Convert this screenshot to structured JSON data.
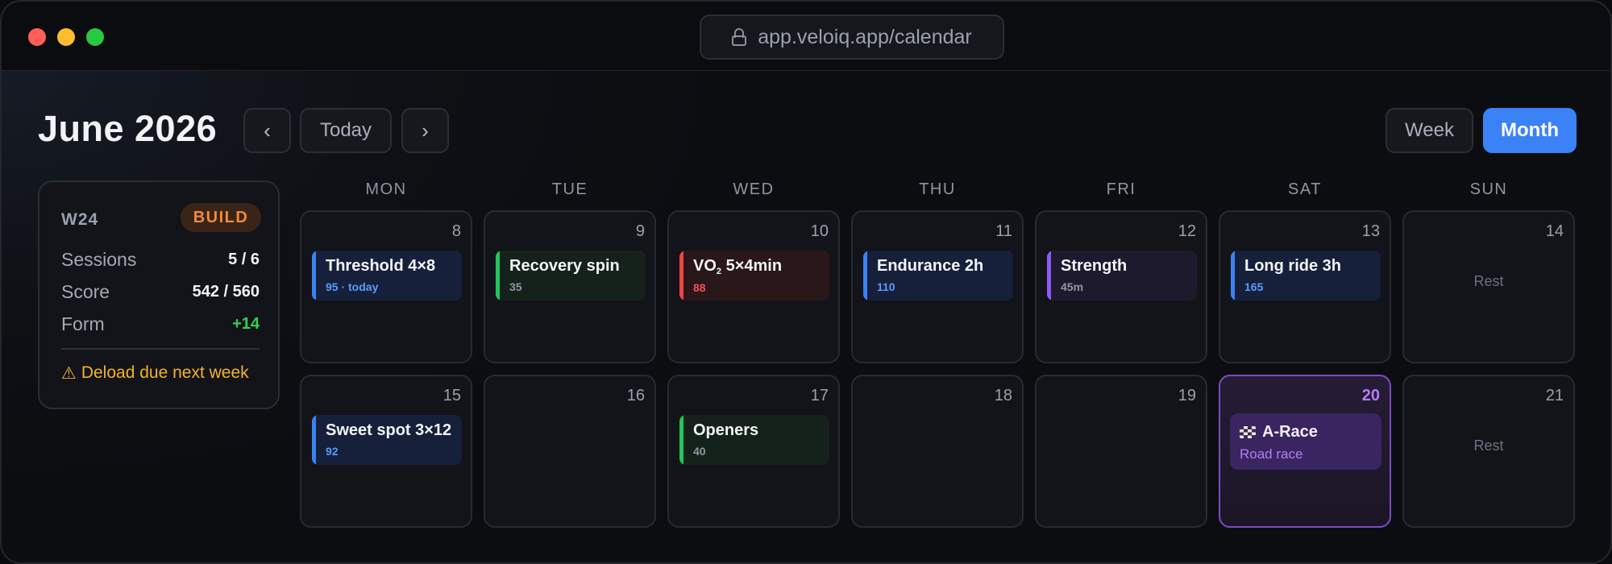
{
  "browser": {
    "url": "app.veloiq.app/calendar"
  },
  "header": {
    "month_title": "June 2026",
    "prev_label": "‹",
    "today_label": "Today",
    "next_label": "›",
    "view_week_label": "Week",
    "view_month_label": "Month",
    "active_view": "Month"
  },
  "week_summary": {
    "week": "W24",
    "phase": "BUILD",
    "sessions_label": "Sessions",
    "sessions_value": "5 / 6",
    "score_label": "Score",
    "score_value": "542 / 560",
    "form_label": "Form",
    "form_value": "+14",
    "alert_icon": "⚠",
    "alert_text": "Deload due next week"
  },
  "weekdays": [
    "MON",
    "TUE",
    "WED",
    "THU",
    "FRI",
    "SAT",
    "SUN"
  ],
  "week1": {
    "d8": {
      "day": "8",
      "title": "Threshold 4×8",
      "meta": "95 · today",
      "color": "#3b82f6"
    },
    "d9": {
      "day": "9",
      "title": "Recovery spin",
      "meta": "35",
      "color": "#22c55e"
    },
    "d10": {
      "day": "10",
      "title_pre": "VO",
      "title_sub": "2",
      "title_post": " 5×4min",
      "meta": "88",
      "color": "#ef4444"
    },
    "d11": {
      "day": "11",
      "title": "Endurance 2h",
      "meta": "110",
      "color": "#3b82f6"
    },
    "d12": {
      "day": "12",
      "title": "Strength",
      "meta": "45m",
      "color": "#8b5cf6"
    },
    "d13": {
      "day": "13",
      "title": "Long ride 3h",
      "meta": "165",
      "color": "#3b82f6"
    },
    "d14": {
      "day": "14",
      "rest": "Rest"
    }
  },
  "week2": {
    "d15": {
      "day": "15",
      "title": "Sweet spot 3×12",
      "meta": "92",
      "color": "#3b82f6"
    },
    "d16": {
      "day": "16"
    },
    "d17": {
      "day": "17",
      "title": "Openers",
      "meta": "40",
      "color": "#22c55e"
    },
    "d18": {
      "day": "18"
    },
    "d19": {
      "day": "19"
    },
    "d20": {
      "day": "20",
      "title": "A-Race",
      "meta": "Road race",
      "icon": "checkered-flag-icon",
      "color": "#a855f7"
    },
    "d21": {
      "day": "21",
      "rest": "Rest"
    }
  }
}
